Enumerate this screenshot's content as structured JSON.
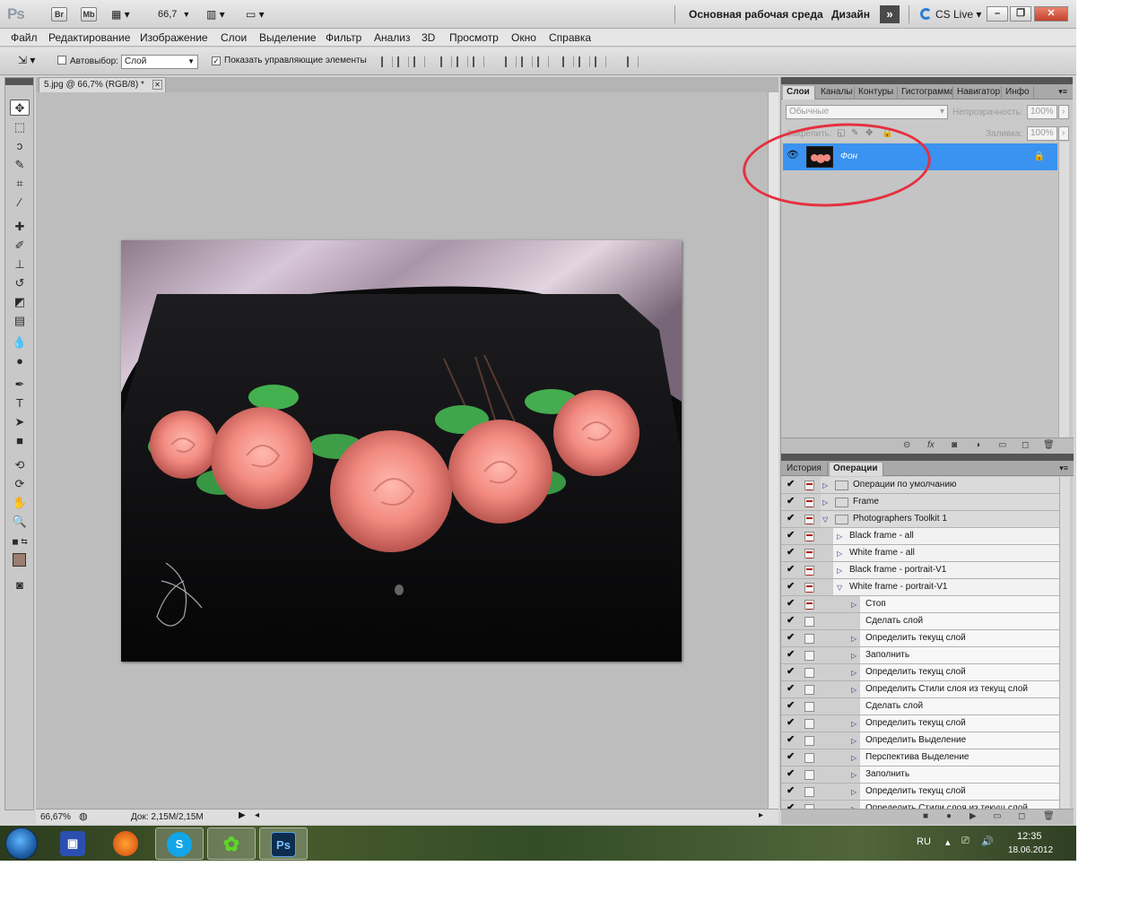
{
  "appbar": {
    "logo": "Ps",
    "bridge_label": "Br",
    "minibridge_label": "Mb",
    "zoom": "66,7",
    "workspace_main": "Основная рабочая среда",
    "workspace_design": "Дизайн",
    "expand_label": "»",
    "cslive": "CS Live"
  },
  "menu": [
    "Файл",
    "Редактирование",
    "Изображение",
    "Слои",
    "Выделение",
    "Фильтр",
    "Анализ",
    "3D",
    "Просмотр",
    "Окно",
    "Справка"
  ],
  "options": {
    "autoselect_label": "Автовыбор:",
    "autoselect_value": "Слой",
    "show_controls_label": "Показать управляющие элементы"
  },
  "document": {
    "tab_title": "5.jpg @ 66,7% (RGB/8) *",
    "status_zoom": "66,67%",
    "status_doc": "Док: 2,15M/2,15M"
  },
  "layers_panel": {
    "tabs": [
      "Слои",
      "Каналы",
      "Контуры",
      "Гистограмма",
      "Навигатор",
      "Инфо"
    ],
    "blend_mode": "Обычные",
    "opacity_label": "Непрозрачность:",
    "opacity_value": "100%",
    "lock_label": "Закрепить:",
    "fill_label": "Заливка:",
    "fill_value": "100%",
    "layer_name": "Фон"
  },
  "actions_panel": {
    "tabs": [
      "История",
      "Операции"
    ],
    "rows": [
      {
        "label": "Операции по умолчанию",
        "level": 0,
        "dialog": true,
        "expanded": false
      },
      {
        "label": "Frame",
        "level": 0,
        "dialog": true,
        "expanded": false
      },
      {
        "label": "Photographers Toolkit 1",
        "level": 0,
        "dialog": true,
        "expanded": true
      },
      {
        "label": "Black frame - all",
        "level": 1,
        "dialog": true,
        "expanded": false
      },
      {
        "label": "White frame - all",
        "level": 1,
        "dialog": true,
        "expanded": false
      },
      {
        "label": "Black frame - portrait-V1",
        "level": 1,
        "dialog": true,
        "expanded": false
      },
      {
        "label": "White frame - portrait-V1",
        "level": 1,
        "dialog": true,
        "expanded": true
      },
      {
        "label": "Стоп",
        "level": 2,
        "dialog": true,
        "tri": true
      },
      {
        "label": "Сделать слой",
        "level": 2,
        "dialog": false,
        "tri": false
      },
      {
        "label": "Определить текущ слой",
        "level": 2,
        "dialog": false,
        "tri": true
      },
      {
        "label": "Заполнить",
        "level": 2,
        "dialog": false,
        "tri": true
      },
      {
        "label": "Определить текущ слой",
        "level": 2,
        "dialog": false,
        "tri": true
      },
      {
        "label": "Определить Стили слоя из текущ слой",
        "level": 2,
        "dialog": false,
        "tri": true
      },
      {
        "label": "Сделать слой",
        "level": 2,
        "dialog": false,
        "tri": false
      },
      {
        "label": "Определить текущ слой",
        "level": 2,
        "dialog": false,
        "tri": true
      },
      {
        "label": "Определить Выделение",
        "level": 2,
        "dialog": false,
        "tri": true
      },
      {
        "label": "Перспектива Выделение",
        "level": 2,
        "dialog": false,
        "tri": true
      },
      {
        "label": "Заполнить",
        "level": 2,
        "dialog": false,
        "tri": true
      },
      {
        "label": "Определить текущ слой",
        "level": 2,
        "dialog": false,
        "tri": true
      },
      {
        "label": "Определить Стили слоя из текущ слой",
        "level": 2,
        "dialog": false,
        "tri": true
      }
    ]
  },
  "taskbar": {
    "lang": "RU",
    "time": "12:35",
    "date": "18.06.2012",
    "ps_label": "Ps"
  },
  "colors": {
    "accent": "#3a93f0",
    "annotation": "#e5303f",
    "foreground_swatch": "#9b7e6f"
  }
}
